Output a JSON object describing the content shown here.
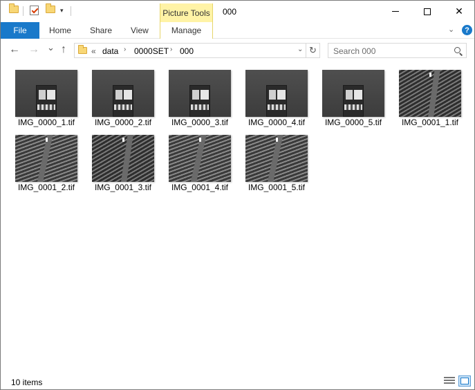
{
  "titlebar": {
    "context_tab": "Picture Tools",
    "title": "000",
    "minimize": "",
    "maximize": "",
    "close": "✕"
  },
  "ribbon": {
    "tabs": [
      "File",
      "Home",
      "Share",
      "View",
      "Manage"
    ],
    "help": "?"
  },
  "nav": {
    "back": "←",
    "forward": "→",
    "recent": "⌄",
    "up": "↑",
    "overflow": "«",
    "breadcrumb": [
      "data",
      "0000SET",
      "000"
    ],
    "refresh": "↻",
    "search_placeholder": "Search 000"
  },
  "files": [
    {
      "name": "IMG_0000_1.tif",
      "kind": "document"
    },
    {
      "name": "IMG_0000_2.tif",
      "kind": "document"
    },
    {
      "name": "IMG_0000_3.tif",
      "kind": "document"
    },
    {
      "name": "IMG_0000_4.tif",
      "kind": "document"
    },
    {
      "name": "IMG_0000_5.tif",
      "kind": "document"
    },
    {
      "name": "IMG_0001_1.tif",
      "kind": "field"
    },
    {
      "name": "IMG_0001_2.tif",
      "kind": "field"
    },
    {
      "name": "IMG_0001_3.tif",
      "kind": "field"
    },
    {
      "name": "IMG_0001_4.tif",
      "kind": "field"
    },
    {
      "name": "IMG_0001_5.tif",
      "kind": "field"
    }
  ],
  "status": {
    "count": "10 items"
  },
  "colors": {
    "file_tab": "#1979ca",
    "picture_tools": "#fff3a6"
  }
}
